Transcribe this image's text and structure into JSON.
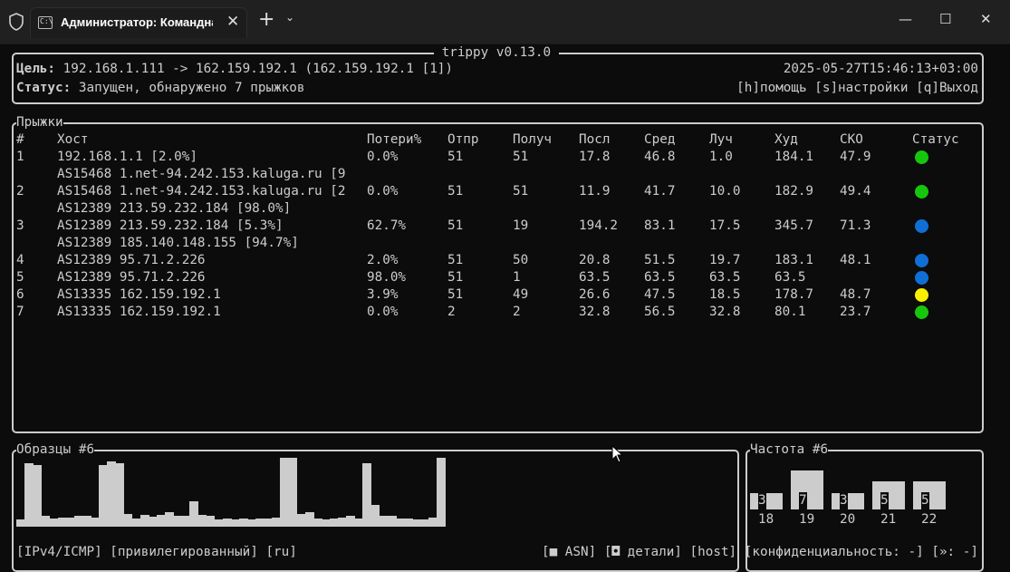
{
  "window": {
    "tab_title": "Администратор: Командная строка",
    "tab_icon_text": "C:\\",
    "new_tab": "+",
    "dropdown": "⌄",
    "close_tab": "✕",
    "minimize": "—",
    "maximize": "☐",
    "close": "✕"
  },
  "app": {
    "title": " trippy v0.13.0 ",
    "target_label": "Цель:",
    "target_value": " 192.168.1.111 -> 162.159.192.1 (162.159.192.1 [1])",
    "timestamp": "2025-05-27T15:46:13+03:00",
    "status_label": "Статус:",
    "status_value": " Запущен, обнаружено 7 прыжков",
    "help": "[h]помощь [s]настройки [q]Выход"
  },
  "hops": {
    "title": "Прыжки",
    "headers": [
      "#",
      "Хост",
      "Потери%",
      "Отпр",
      "Получ",
      "Посл",
      "Сред",
      "Луч",
      "Худ",
      "СКО",
      "Статус"
    ],
    "rows": [
      {
        "num": "1",
        "host": "192.168.1.1 [2.0%]",
        "loss": "0.0%",
        "snt": "51",
        "recv": "51",
        "last": "17.8",
        "avg": "46.8",
        "best": "1.0",
        "wrst": "184.1",
        "stdev": "47.9",
        "status": "green"
      },
      {
        "num": "",
        "host": "AS15468 1.net-94.242.153.kaluga.ru [9",
        "loss": "",
        "snt": "",
        "recv": "",
        "last": "",
        "avg": "",
        "best": "",
        "wrst": "",
        "stdev": "",
        "status": ""
      },
      {
        "num": "2",
        "host": "AS15468 1.net-94.242.153.kaluga.ru [2",
        "loss": "0.0%",
        "snt": "51",
        "recv": "51",
        "last": "11.9",
        "avg": "41.7",
        "best": "10.0",
        "wrst": "182.9",
        "stdev": "49.4",
        "status": "green"
      },
      {
        "num": "",
        "host": "AS12389 213.59.232.184 [98.0%]",
        "loss": "",
        "snt": "",
        "recv": "",
        "last": "",
        "avg": "",
        "best": "",
        "wrst": "",
        "stdev": "",
        "status": ""
      },
      {
        "num": "3",
        "host": "AS12389 213.59.232.184 [5.3%]",
        "loss": "62.7%",
        "snt": "51",
        "recv": "19",
        "last": "194.2",
        "avg": "83.1",
        "best": "17.5",
        "wrst": "345.7",
        "stdev": "71.3",
        "status": "blue"
      },
      {
        "num": "",
        "host": "AS12389 185.140.148.155 [94.7%]",
        "loss": "",
        "snt": "",
        "recv": "",
        "last": "",
        "avg": "",
        "best": "",
        "wrst": "",
        "stdev": "",
        "status": ""
      },
      {
        "num": "4",
        "host": "AS12389 95.71.2.226",
        "loss": "2.0%",
        "snt": "51",
        "recv": "50",
        "last": "20.8",
        "avg": "51.5",
        "best": "19.7",
        "wrst": "183.1",
        "stdev": "48.1",
        "status": "blue"
      },
      {
        "num": "5",
        "host": "AS12389 95.71.2.226",
        "loss": "98.0%",
        "snt": "51",
        "recv": "1",
        "last": "63.5",
        "avg": "63.5",
        "best": "63.5",
        "wrst": "63.5",
        "stdev": "",
        "status": "blue"
      },
      {
        "num": "6",
        "host": "AS13335 162.159.192.1",
        "loss": "3.9%",
        "snt": "51",
        "recv": "49",
        "last": "26.6",
        "avg": "47.5",
        "best": "18.5",
        "wrst": "178.7",
        "stdev": "48.7",
        "status": "yellow"
      },
      {
        "num": "7",
        "host": "AS13335 162.159.192.1",
        "loss": "0.0%",
        "snt": "2",
        "recv": "2",
        "last": "32.8",
        "avg": "56.5",
        "best": "32.8",
        "wrst": "80.1",
        "stdev": "23.7",
        "status": "green"
      }
    ]
  },
  "status_colors": {
    "green": "#16c60c",
    "blue": "#0f6fd6",
    "yellow": "#f9f100"
  },
  "samples": {
    "title": "Образцы #6",
    "values": [
      8,
      70,
      68,
      12,
      9,
      10,
      10,
      12,
      12,
      10,
      68,
      72,
      70,
      14,
      9,
      13,
      11,
      13,
      16,
      12,
      12,
      28,
      13,
      12,
      8,
      9,
      8,
      9,
      8,
      9,
      9,
      10,
      76,
      76,
      14,
      16,
      9,
      8,
      9,
      10,
      12,
      9,
      70,
      24,
      12,
      12,
      9,
      9,
      8,
      8,
      10,
      76
    ]
  },
  "frequency": {
    "title": "Частота #6",
    "bins": [
      {
        "label": "18",
        "count": "3",
        "value": 3
      },
      {
        "label": "19",
        "count": "7",
        "value": 7
      },
      {
        "label": "20",
        "count": "3",
        "value": 3
      },
      {
        "label": "21",
        "count": "5",
        "value": 5
      },
      {
        "label": "22",
        "count": "5",
        "value": 5
      }
    ]
  },
  "footer": {
    "left": "[IPv4/ICMP] [привилегированный] [ru]",
    "right": "[■ ASN] [◘ детали] [host] [конфиденциальность: -] [»: -]"
  }
}
